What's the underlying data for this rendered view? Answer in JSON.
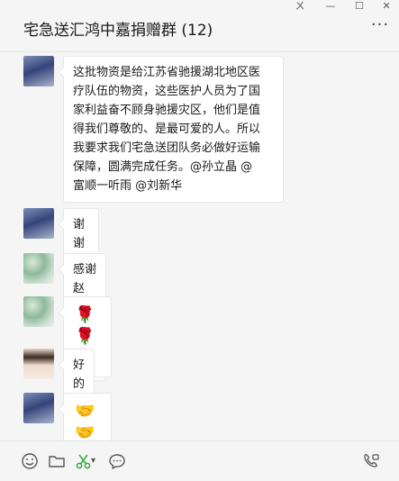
{
  "header": {
    "title": "宅急送汇鸿中嘉捐赠群 (12)"
  },
  "window_controls": {
    "pin_icon": "pin-icon",
    "minimize_icon": "minimize-icon",
    "maximize_icon": "maximize-icon",
    "close_icon": "close-icon",
    "pin_glyph": "ㄨ",
    "minimize_glyph": "—",
    "maximize_glyph": "☐",
    "close_glyph": "✕"
  },
  "more_label": "···",
  "messages": [
    {
      "sender_avatar": "avatar-couple-blue",
      "lines": [
        "这批物资是给江苏省驰援湖北地区医",
        "疗队伍的物资，这些医护人员为了国",
        "家利益奋不顾身驰援灾区，他们是值",
        "得我们尊敬的、是最可爱的人。所以",
        "我要求我们宅急送团队务必做好运输",
        "保障，圆满完成任务。@孙立晶 @",
        "富顺一听雨 @刘新华"
      ]
    },
    {
      "sender_avatar": "avatar-couple-blue",
      "text": "谢谢大家!"
    },
    {
      "sender_avatar": "avatar-flowers-green",
      "text": "感谢赵总，感谢宅急送"
    },
    {
      "sender_avatar": "avatar-flowers-green",
      "emoji": "🌹 🌹 🌹"
    },
    {
      "sender_avatar": "avatar-woman",
      "text": "好的赵总"
    },
    {
      "sender_avatar": "avatar-couple-blue",
      "emoji": "🤝 🤝"
    }
  ],
  "toolbar": {
    "emoji_icon": "smiley-icon",
    "folder_icon": "folder-icon",
    "scissors_icon": "scissors-icon",
    "dropdown_glyph": "▾",
    "chat_icon": "chat-bubble-icon",
    "call_icon": "phone-call-icon"
  },
  "colors": {
    "background": "#f5f5f5",
    "bubble": "#ffffff",
    "scissors_accent": "#2eaa3c",
    "text": "#1a1a1a"
  }
}
